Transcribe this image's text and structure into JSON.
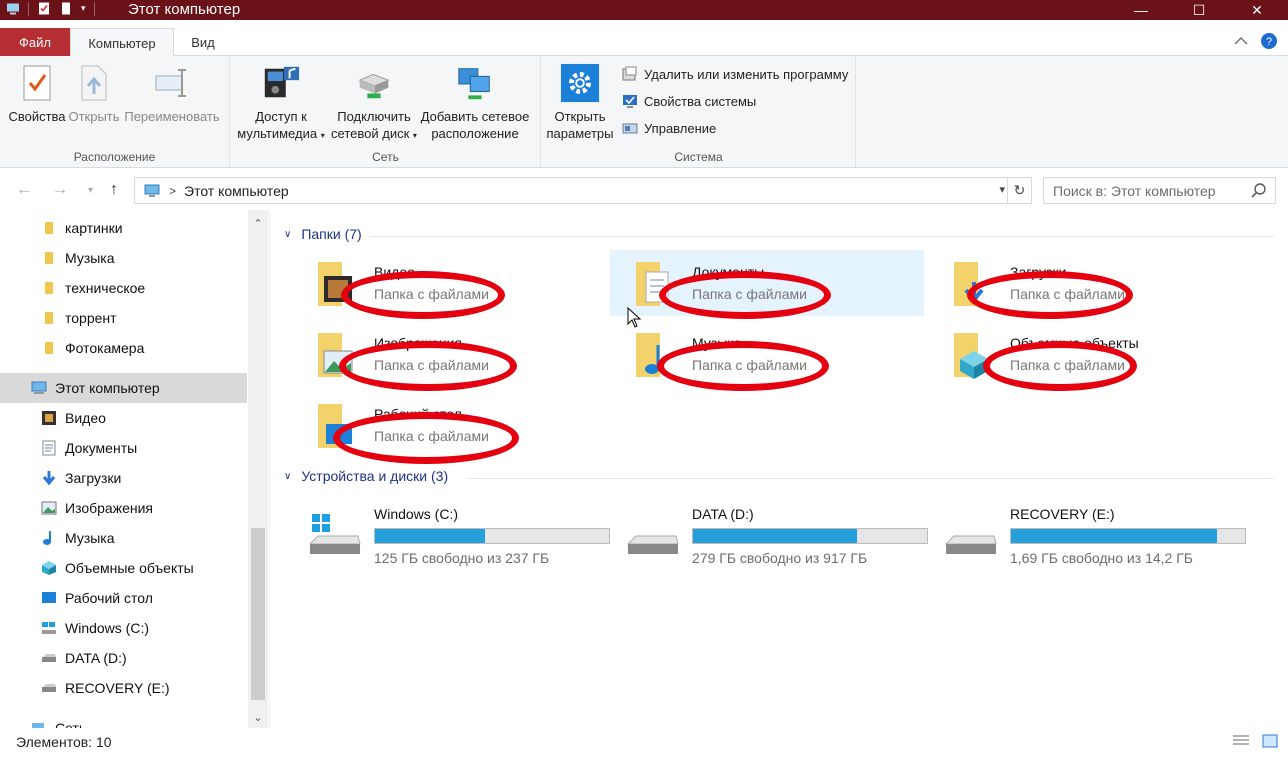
{
  "window": {
    "title": "Этот компьютер",
    "controls": {
      "minimize": "—",
      "maximize": "☐",
      "close": "✕"
    }
  },
  "ribbon_tabs": {
    "file": "Файл",
    "computer": "Компьютер",
    "view": "Вид"
  },
  "ribbon": {
    "location": {
      "label": "Расположение",
      "properties": "Свойства",
      "open": "Открыть",
      "rename": "Переименовать"
    },
    "network": {
      "label": "Сеть",
      "media_line1": "Доступ к",
      "media_line2": "мультимедиа",
      "map_line1": "Подключить",
      "map_line2": "сетевой диск",
      "add_line1": "Добавить сетевое",
      "add_line2": "расположение"
    },
    "system": {
      "label": "Система",
      "settings_line1": "Открыть",
      "settings_line2": "параметры",
      "uninstall": "Удалить или изменить программу",
      "sysprops": "Свойства системы",
      "manage": "Управление"
    }
  },
  "address": {
    "path": "Этот компьютер",
    "search_placeholder": "Поиск в: Этот компьютер"
  },
  "sidebar": {
    "items": [
      {
        "label": "картинки",
        "icon": "folder-icon"
      },
      {
        "label": "Музыка",
        "icon": "folder-icon"
      },
      {
        "label": "техническое",
        "icon": "folder-icon"
      },
      {
        "label": "торрент",
        "icon": "folder-icon"
      },
      {
        "label": "Фотокамера",
        "icon": "folder-icon"
      },
      {
        "label": "Этот компьютер",
        "icon": "computer-icon"
      },
      {
        "label": "Видео",
        "icon": "video-icon"
      },
      {
        "label": "Документы",
        "icon": "documents-icon"
      },
      {
        "label": "Загрузки",
        "icon": "downloads-icon"
      },
      {
        "label": "Изображения",
        "icon": "pictures-icon"
      },
      {
        "label": "Музыка",
        "icon": "music-icon"
      },
      {
        "label": "Объемные объекты",
        "icon": "3d-objects-icon"
      },
      {
        "label": "Рабочий стол",
        "icon": "desktop-icon"
      },
      {
        "label": "Windows (C:)",
        "icon": "windows-drive-icon"
      },
      {
        "label": "DATA (D:)",
        "icon": "drive-icon"
      },
      {
        "label": "RECOVERY (E:)",
        "icon": "drive-icon"
      },
      {
        "label": "Сеть",
        "icon": "network-icon"
      }
    ]
  },
  "content": {
    "folders_header": "Папки (7)",
    "folders": [
      {
        "name": "Видео",
        "sub": "Папка с файлами"
      },
      {
        "name": "Документы",
        "sub": "Папка с файлами"
      },
      {
        "name": "Загрузки",
        "sub": "Папка с файлами"
      },
      {
        "name": "Изображения",
        "sub": "Папка с файлами"
      },
      {
        "name": "Музыка",
        "sub": "Папка с файлами"
      },
      {
        "name": "Объемные объекты",
        "sub": "Папка с файлами"
      },
      {
        "name": "Рабочий стол",
        "sub": "Папка с файлами"
      }
    ],
    "drives_header": "Устройства и диски (3)",
    "drives": [
      {
        "name": "Windows (C:)",
        "free": "125 ГБ свободно из 237 ГБ",
        "used_fraction": 0.47
      },
      {
        "name": "DATA (D:)",
        "free": "279 ГБ свободно из 917 ГБ",
        "used_fraction": 0.7
      },
      {
        "name": "RECOVERY (E:)",
        "free": "1,69 ГБ свободно из 14,2 ГБ",
        "used_fraction": 0.88
      }
    ]
  },
  "status": {
    "count": "Элементов: 10"
  },
  "colors": {
    "titlebar": "#6b1118",
    "file_tab": "#b52e31",
    "accent": "#26a0da",
    "annotation": "#e4000f"
  }
}
